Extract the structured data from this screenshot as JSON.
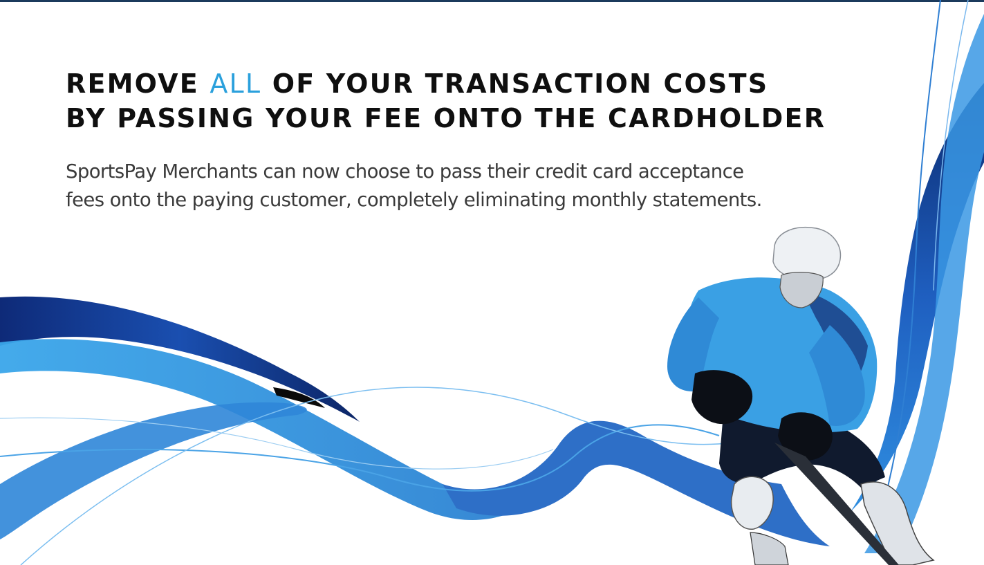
{
  "headline": {
    "line1_before": "REMOVE ",
    "line1_accent": "ALL",
    "line1_after": " OF YOUR TRANSACTION COSTS",
    "line2": "BY PASSING YOUR FEE ONTO THE CARDHOLDER"
  },
  "body": {
    "line1": "SportsPay Merchants can now choose to pass their credit card acceptance",
    "line2": "fees onto the paying customer, completely eliminating monthly statements."
  },
  "illustration": {
    "subject": "hockey-player",
    "accent_color": "#2aa0dc",
    "dark_blue": "#12307a",
    "mid_blue": "#2f6fc4"
  }
}
